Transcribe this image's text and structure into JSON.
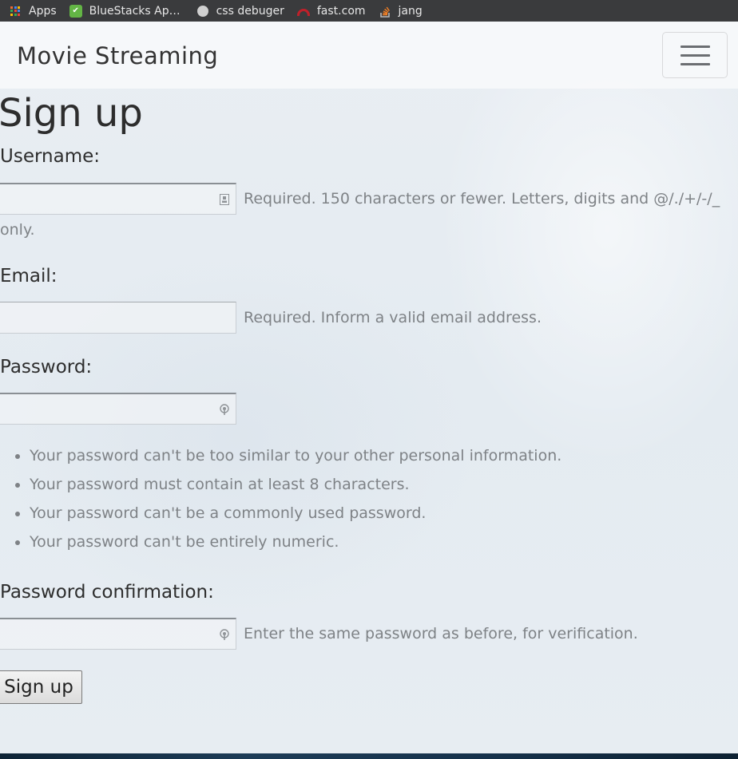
{
  "bookmarks": [
    {
      "label": "Apps",
      "icon": "apps-grid-icon"
    },
    {
      "label": "BlueStacks Ap…",
      "icon": "bluestacks-icon"
    },
    {
      "label": "css debuger",
      "icon": "globe-icon"
    },
    {
      "label": "fast.com",
      "icon": "fast-speedometer-icon"
    },
    {
      "label": "jang",
      "icon": "stackoverflow-icon"
    }
  ],
  "navbar": {
    "brand": "Movie Streaming",
    "toggler_icon": "hamburger-menu-icon"
  },
  "page": {
    "title": "Sign up"
  },
  "form": {
    "username": {
      "label": "Username:",
      "value": "",
      "help": "Required. 150 characters or fewer. Letters, digits and @/./+/-/_ only."
    },
    "email": {
      "label": "Email:",
      "value": "",
      "help": "Required. Inform a valid email address."
    },
    "password": {
      "label": "Password:",
      "value": "",
      "rules": [
        "Your password can't be too similar to your other personal information.",
        "Your password must contain at least 8 characters.",
        "Your password can't be a commonly used password.",
        "Your password can't be entirely numeric."
      ]
    },
    "password_confirmation": {
      "label": "Password confirmation:",
      "value": "",
      "help": "Enter the same password as before, for verification."
    },
    "submit_label": "Sign up"
  },
  "colors": {
    "bookmarks_bar": "#3a3b3d",
    "help_text": "#7e8286",
    "text": "#2d2d2d"
  }
}
